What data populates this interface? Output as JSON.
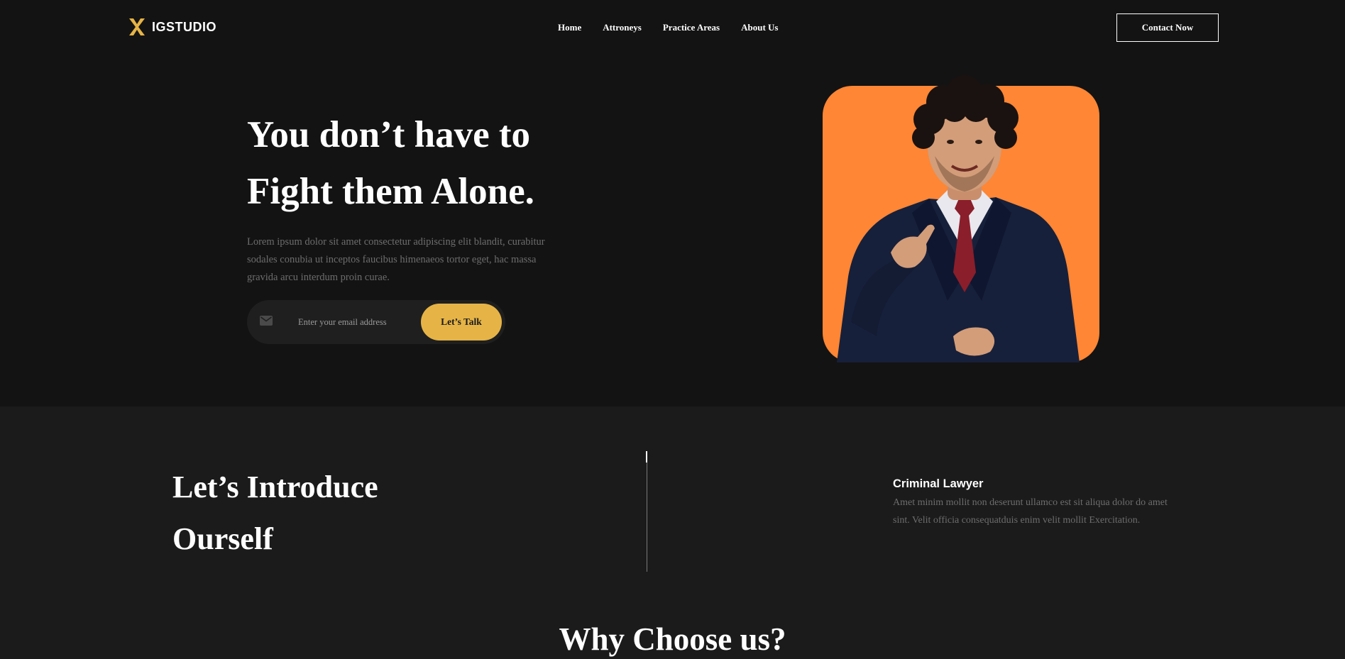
{
  "brand": {
    "name": "IGSTUDIO",
    "accent_color": "#e6b446",
    "logo_icon": "x-logo-icon"
  },
  "nav": {
    "items": [
      {
        "label": "Home"
      },
      {
        "label": "Attroneys"
      },
      {
        "label": "Practice Areas"
      },
      {
        "label": "About Us"
      }
    ],
    "cta_label": "Contact Now"
  },
  "hero": {
    "title_line1": "You don’t have to",
    "title_line2": "Fight them Alone.",
    "subtitle": "Lorem ipsum dolor sit amet consectetur adipiscing elit blandit, curabitur sodales conubia ut inceptos faucibus himenaeos tortor eget, hac massa gravida arcu interdum proin curae.",
    "email_placeholder": "Enter your email address",
    "email_icon": "mail-icon",
    "submit_label": "Let’s Talk",
    "photo_bg_color": "#fe8634"
  },
  "intro": {
    "title_line1": "Let’s Introduce",
    "title_line2": "Ourself",
    "service": {
      "title": "Criminal Lawyer",
      "text": "Amet minim mollit non deserunt ullamco est sit aliqua dolor do amet sint. Velit officia consequatduis enim velit mollit Exercitation."
    }
  },
  "why": {
    "title": "Why Choose us?"
  }
}
